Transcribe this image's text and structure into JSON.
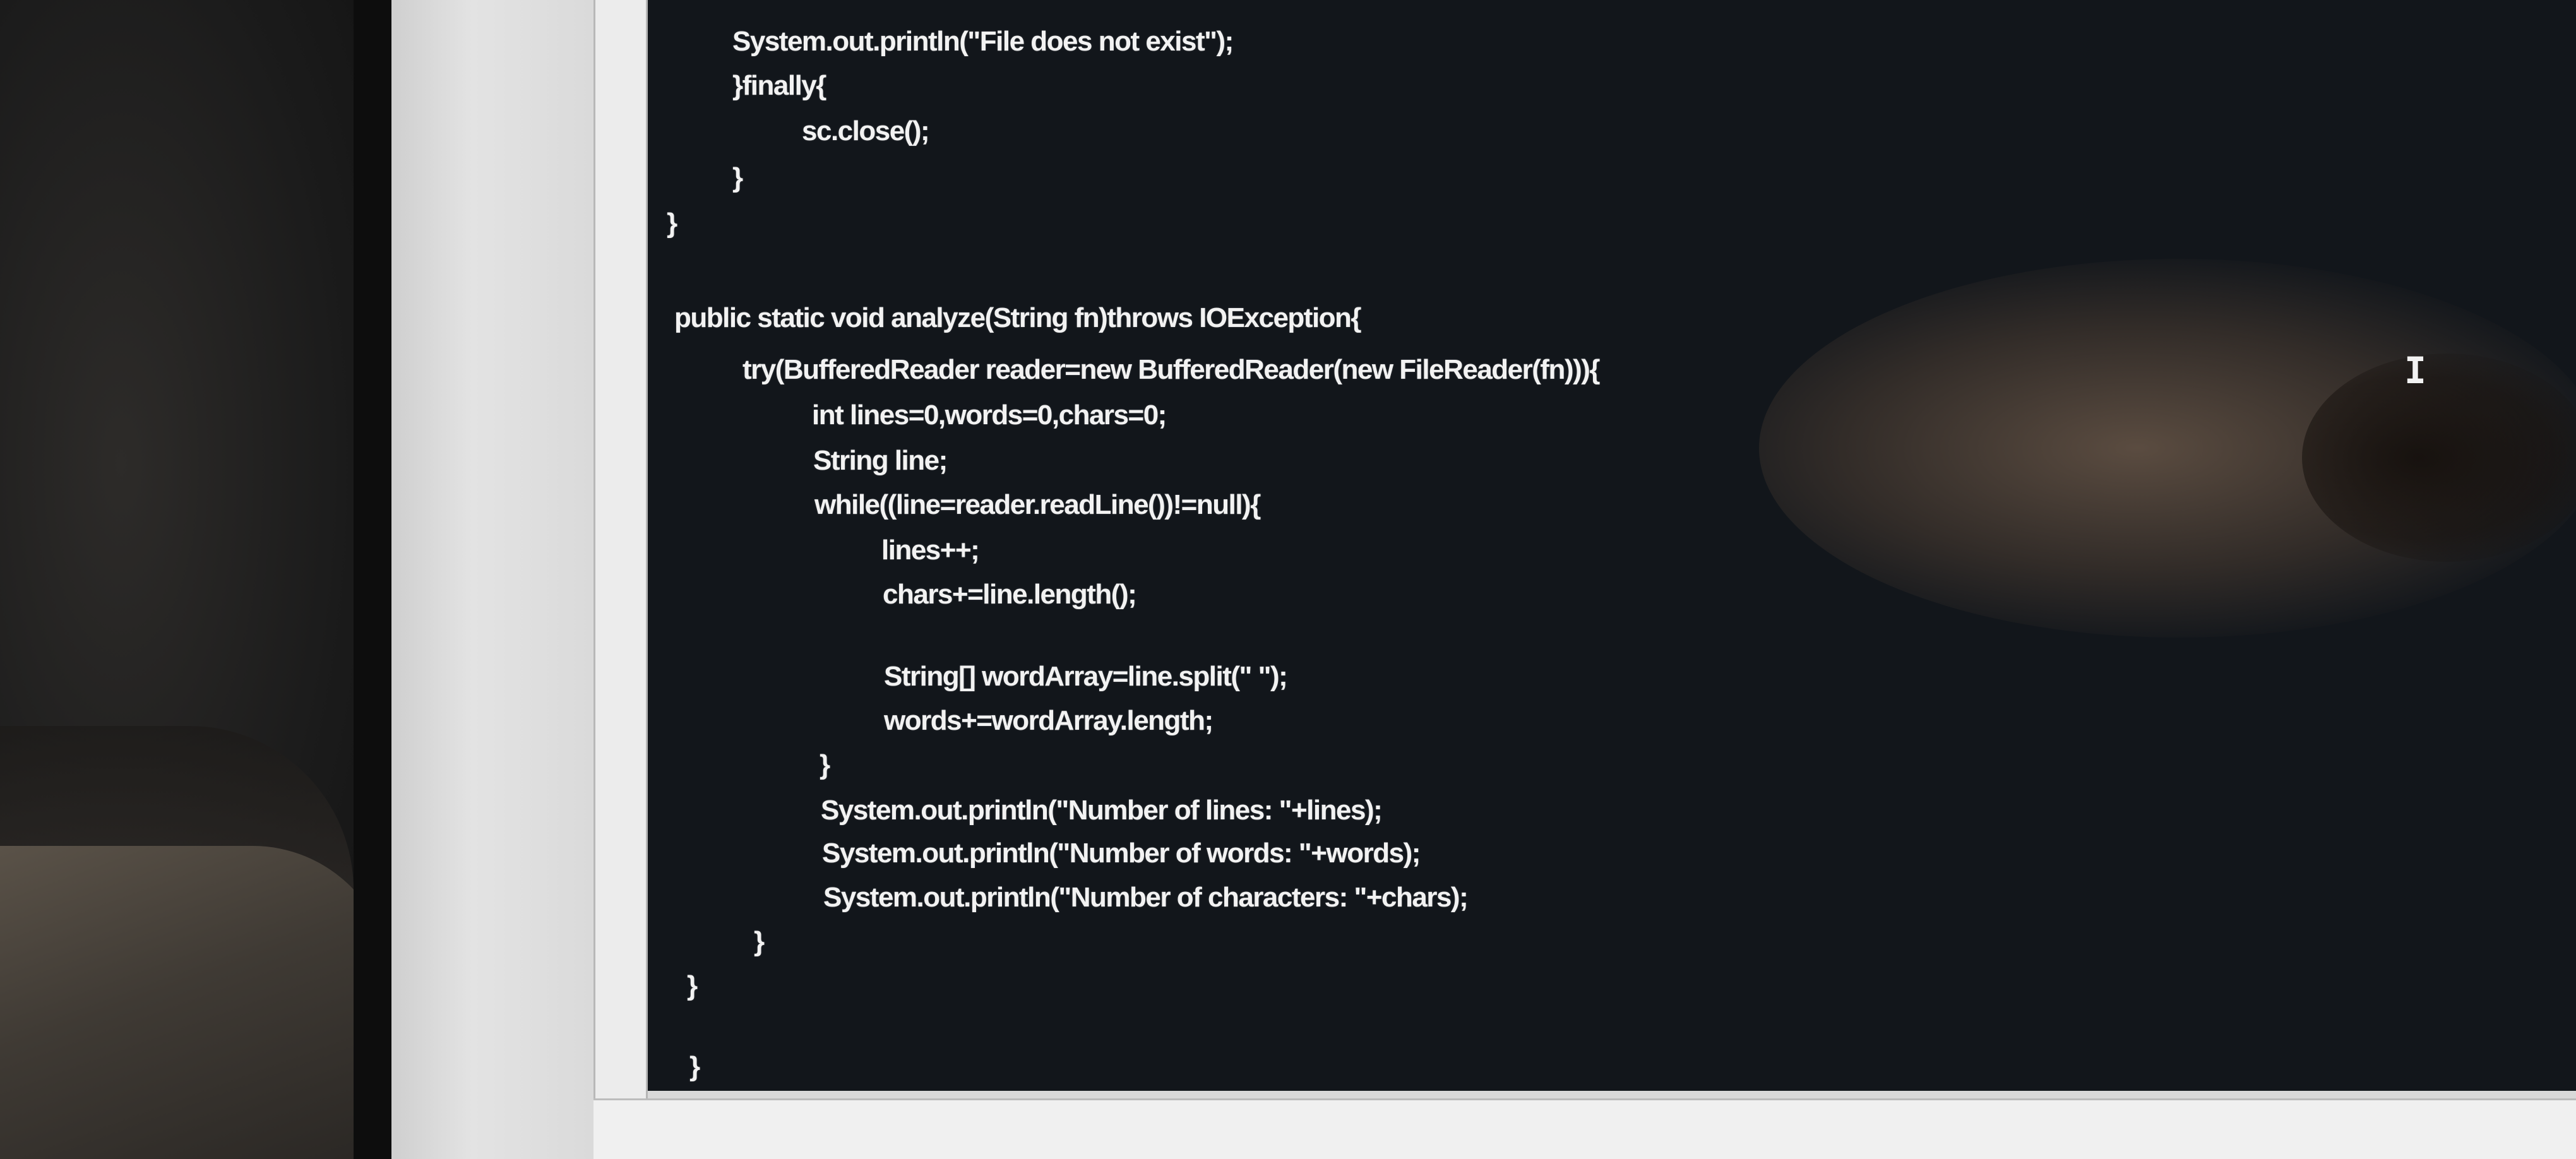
{
  "editor": {
    "code_lines": [
      "System.out.println(\"File does not exist\");",
      "}finally{",
      "sc.close();",
      "}",
      "}",
      "public static void analyze(String fn)throws IOException{",
      "try(BufferedReader reader=new BufferedReader(new FileReader(fn))){",
      "int lines=0,words=0,chars=0;",
      "String line;",
      "while((line=reader.readLine())!=null){",
      "lines++;",
      "chars+=line.length();",
      "String[] wordArray=line.split(\" \");",
      "words+=wordArray.length;",
      "}",
      "System.out.println(\"Number of lines: \"+lines);",
      "System.out.println(\"Number of words: \"+words);",
      "System.out.println(\"Number of characters: \"+chars);",
      "}",
      "}",
      "}"
    ],
    "cursor_glyph": "I"
  },
  "colors": {
    "editor_background": "#12161b",
    "code_text": "#f2f2f2",
    "window_frame": "#d9d9d9"
  },
  "icons": [
    "text-cursor-icon"
  ]
}
